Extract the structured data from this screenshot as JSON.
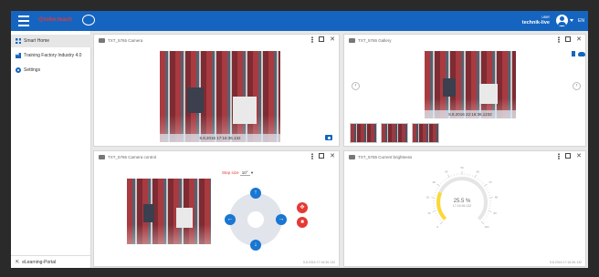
{
  "topbar": {
    "logo_text": "@robo:teach",
    "user_line1": "user",
    "user_line2": "technik-live",
    "lang": "EN"
  },
  "sidebar": {
    "items": [
      {
        "label": "Smart Home",
        "icon": "grid-icon",
        "active": true
      },
      {
        "label": "Training Factory Industry 4.0",
        "icon": "factory-icon",
        "active": false
      },
      {
        "label": "Settings",
        "icon": "gear-icon",
        "active": false
      }
    ],
    "portal": "eLearning-Portal"
  },
  "panels": {
    "camera": {
      "title": "TXT_5765 Camera",
      "overlay": "5.8.2016 17:16:36.132"
    },
    "gallery": {
      "title": "TXT_5765 Gallery",
      "overlay": "5.8.2016 22:16:36.1232"
    },
    "camera_control": {
      "title": "TXT_5765 Camera control",
      "step_label": "Step size",
      "step_value": "10°",
      "stamp": "5.8.2016 17:16:36.132"
    },
    "brightness": {
      "title": "TXT_5765 Current brightness",
      "value": "25.5 %",
      "subvalue": "17:16:36.132",
      "stamp": "5.8.2016 17:16:36.132"
    }
  },
  "gauge": {
    "value_percent": 25.5,
    "min": 0,
    "max": 100,
    "ticks": [
      "0",
      "10",
      "20",
      "30",
      "40",
      "50",
      "60",
      "70",
      "80",
      "90",
      "100"
    ]
  },
  "colors": {
    "accent": "#1565c0",
    "danger": "#e53935",
    "gauge_fill": "#fdd835"
  }
}
